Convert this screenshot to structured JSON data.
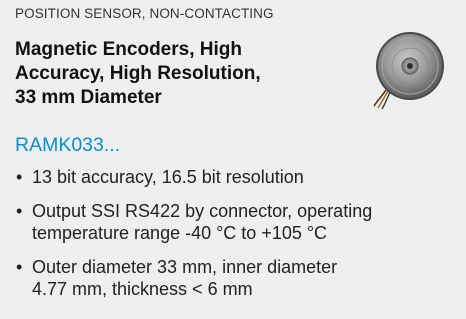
{
  "category": "POSITION SENSOR, NON-CONTACTING",
  "title_lines": [
    "Magnetic Encoders, High",
    "Accuracy, High Resolution,",
    "33 mm Diameter"
  ],
  "part_number": "RAMK033...",
  "bullet_glyph": "•",
  "bullets": [
    {
      "lines": [
        "13 bit accuracy, 16.5 bit resolution"
      ]
    },
    {
      "lines": [
        "Output SSI RS422 by connector, operating",
        "temperature range -40 °C to +105 °C"
      ]
    },
    {
      "lines": [
        "Outer diameter 33 mm, inner diameter",
        "4.77 mm, thickness < 6 mm"
      ]
    }
  ],
  "colors": {
    "background": "#efefef",
    "link": "#0a8fcf",
    "text": "#1a1a1a"
  },
  "image": {
    "subject": "encoder-photo"
  }
}
